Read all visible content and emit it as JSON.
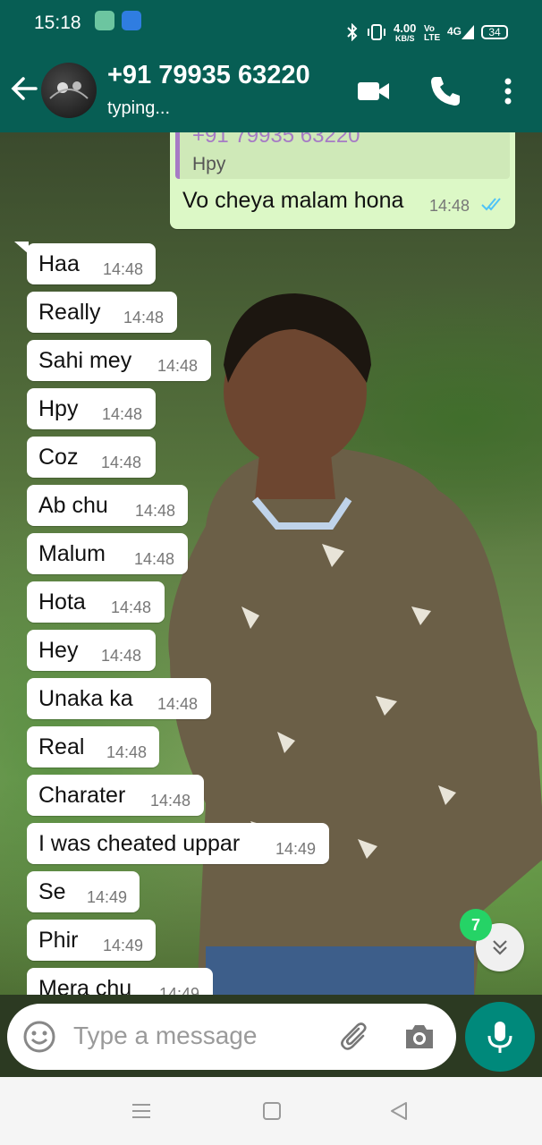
{
  "status_bar": {
    "time": "15:18",
    "network_speed": "4.00",
    "network_unit": "KB/S",
    "volte": "Vo LTE",
    "signal": "4G",
    "battery": "34"
  },
  "header": {
    "contact_name": "+91 79935 63220",
    "status": "typing..."
  },
  "outgoing_message": {
    "quoted_sender": "+91 79935 63220",
    "quoted_text": "Hpy",
    "text": "Vo cheya malam hona",
    "time": "14:48",
    "read_status": "read"
  },
  "messages": [
    {
      "text": "Haa",
      "time": "14:48"
    },
    {
      "text": "Really",
      "time": "14:48"
    },
    {
      "text": "Sahi mey",
      "time": "14:48"
    },
    {
      "text": "Hpy",
      "time": "14:48"
    },
    {
      "text": "Coz",
      "time": "14:48"
    },
    {
      "text": "Ab chu",
      "time": "14:48"
    },
    {
      "text": "Malum",
      "time": "14:48"
    },
    {
      "text": "Hota",
      "time": "14:48"
    },
    {
      "text": "Hey",
      "time": "14:48"
    },
    {
      "text": "Unaka ka",
      "time": "14:48"
    },
    {
      "text": "Real",
      "time": "14:48"
    },
    {
      "text": "Charater",
      "time": "14:48"
    },
    {
      "text": "I was cheated uppar",
      "time": "14:49"
    },
    {
      "text": "Se",
      "time": "14:49"
    },
    {
      "text": "Phir",
      "time": "14:49"
    },
    {
      "text": "Mera chu",
      "time": "14:49"
    }
  ],
  "unread_count": "7",
  "composer": {
    "placeholder": "Type a message"
  },
  "colors": {
    "header": "#075e54",
    "outgoing_bubble": "#dcf8c6",
    "incoming_bubble": "#ffffff",
    "mic_button": "#00897b",
    "unread_badge": "#25d366",
    "read_ticks": "#4fc3f7"
  },
  "icons": {
    "back": "arrow-left-icon",
    "video": "video-call-icon",
    "call": "phone-icon",
    "menu": "more-vertical-icon",
    "emoji": "emoji-icon",
    "attach": "paperclip-icon",
    "camera": "camera-icon",
    "mic": "microphone-icon",
    "scroll": "double-chevron-down-icon"
  }
}
